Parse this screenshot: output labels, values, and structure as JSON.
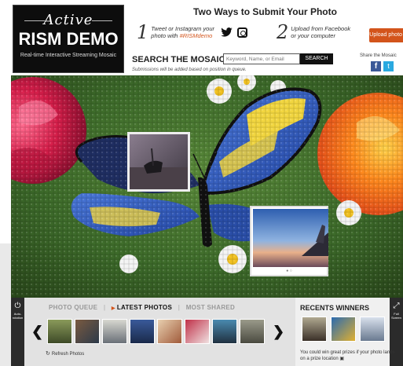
{
  "logo": {
    "active": "Active",
    "title": "RISM DEMO",
    "subtitle": "Real-time Interactive Streaming Mosaic"
  },
  "header": {
    "title": "Two Ways to Submit Your Photo",
    "step1": {
      "num": "1",
      "text_a": "Tweet or Instagram your",
      "text_b": "photo with ",
      "hashtag": "#RISMdemo"
    },
    "step2": {
      "num": "2",
      "text_a": "Upload from Facebook",
      "text_b": "or your computer"
    },
    "upload_label": "Upload photo ❯",
    "search_title": "SEARCH THE MOSAIC",
    "search_placeholder": "Keyword, Name, or Email",
    "search_button": "SEARCH",
    "note": "Submissions will be added based on position in queue.",
    "share_label": "Share the Mosaic",
    "fb_glyph": "f",
    "tw_glyph": "t"
  },
  "mosaic": {
    "photo2_caption": "● ○"
  },
  "bottom": {
    "left_ctrl": "Auto-rotation",
    "right_ctrl": "Full Screen",
    "tabs": [
      "PHOTO QUEUE",
      "LATEST PHOTOS",
      "MOST SHARED"
    ],
    "tab_sep": "|",
    "arrow_left": "❮",
    "arrow_right": "❯",
    "refresh": "Refresh Photos",
    "refresh_icon": "↻",
    "winners_title": "RECENTS WINNERS",
    "prize_text": "You could win great prizes if your photo lands on a prize location ▣"
  },
  "colors": {
    "accent": "#d3541b",
    "facebook": "#3b5998",
    "twitter": "#2aa9e0"
  }
}
